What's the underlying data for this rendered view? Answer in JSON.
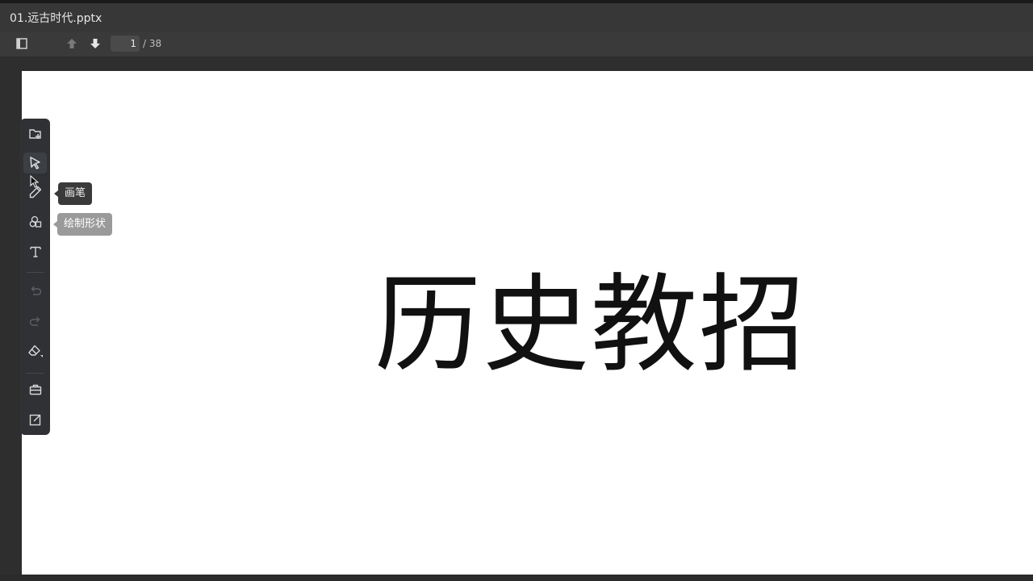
{
  "window": {
    "title": "01.远古时代.pptx"
  },
  "toolbar": {
    "sidebar_toggle_icon": "sidebar-icon",
    "prev_page_icon": "arrow-up-icon",
    "next_page_icon": "arrow-down-icon",
    "current_page": "1",
    "page_total": "/ 38"
  },
  "slide": {
    "title": "历史教招"
  },
  "tools": {
    "items": [
      {
        "icon": "add-slide-icon"
      },
      {
        "icon": "select-cursor-icon",
        "active": true
      },
      {
        "icon": "pen-icon"
      },
      {
        "icon": "shapes-icon"
      },
      {
        "icon": "text-icon"
      },
      {
        "icon": "undo-icon"
      },
      {
        "icon": "redo-icon"
      },
      {
        "icon": "eraser-icon"
      },
      {
        "icon": "toolbox-icon"
      },
      {
        "icon": "edit-icon"
      }
    ],
    "tooltip_pen": "画笔",
    "tooltip_shapes": "绘制形状"
  },
  "colors": {
    "panel": "#2f3134",
    "slide_bg": "#ffffff",
    "text": "#111111"
  }
}
